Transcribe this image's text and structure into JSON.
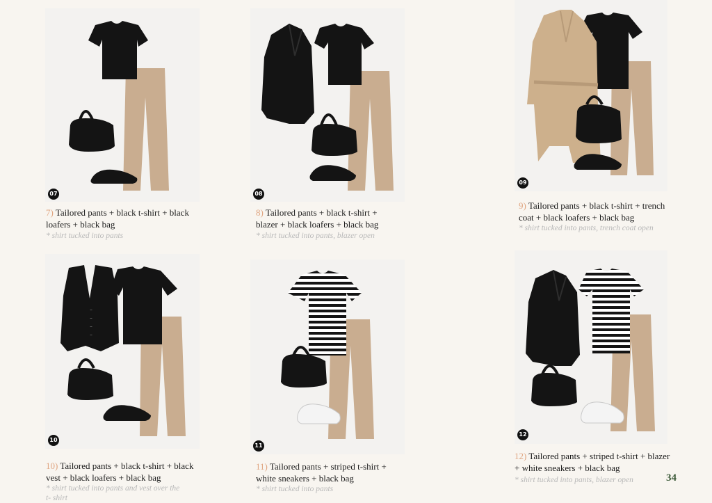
{
  "outfits": [
    {
      "badge": "07",
      "number": "7)",
      "title_lines": [
        "Tailored pants + black t-shirt + black",
        "loafers + black bag"
      ],
      "note_lines": [
        "* shirt tucked into pants"
      ]
    },
    {
      "badge": "08",
      "number": "8)",
      "title_lines": [
        "Tailored pants + black t-shirt +",
        "blazer + black loafers + black bag"
      ],
      "note_lines": [
        "* shirt tucked into pants, blazer open"
      ]
    },
    {
      "badge": "09",
      "number": "9)",
      "title_lines": [
        "Tailored pants + black t-shirt + trench",
        "coat + black loafers + black bag"
      ],
      "note_lines": [
        "* shirt tucked into pants, trench coat open"
      ]
    },
    {
      "badge": "10",
      "number": "10)",
      "title_lines": [
        "Tailored pants + black t-shirt + black",
        "vest + black loafers + black bag"
      ],
      "note_lines": [
        "* shirt tucked into pants and vest over the",
        "t- shirt"
      ]
    },
    {
      "badge": "11",
      "number": "11)",
      "title_lines": [
        "Tailored pants + striped t-shirt +",
        "white sneakers + black bag"
      ],
      "note_lines": [
        "* shirt tucked into pants"
      ]
    },
    {
      "badge": "12",
      "number": "12)",
      "title_lines": [
        "Tailored pants + striped t-shirt + blazer",
        "+ white sneakers + black bag"
      ],
      "note_lines": [
        "* shirt tucked into pants, blazer open"
      ]
    }
  ],
  "page_number": "34",
  "colors": {
    "accent": "#e0a682",
    "background": "#f8f5f0",
    "panel": "#f3f2f0",
    "camel": "#c9ad90",
    "trench": "#cdb08c",
    "black": "#141414",
    "page_number": "#3e5b3a"
  }
}
